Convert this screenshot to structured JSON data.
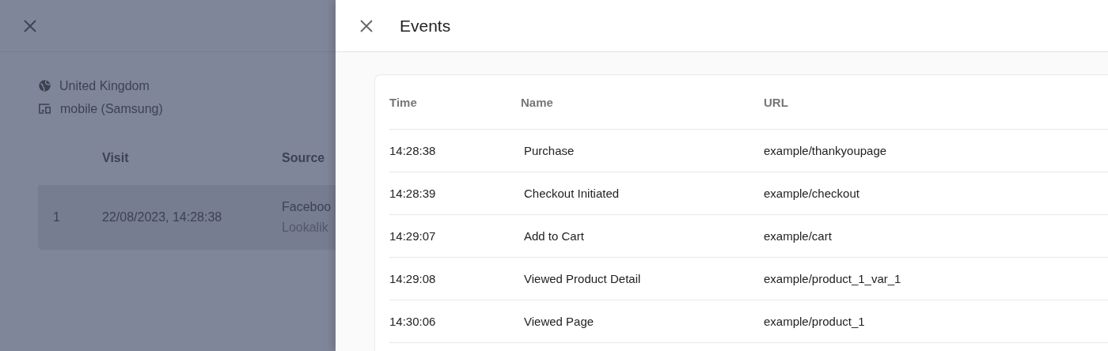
{
  "background_page": {
    "location": "United Kingdom",
    "device": "mobile (Samsung)",
    "visits_table": {
      "columns": [
        "Visit",
        "Source"
      ],
      "rows": [
        {
          "number": "1",
          "visit": "22/08/2023, 14:28:38",
          "source": "Faceboo",
          "campaign": "Lookalik"
        }
      ]
    }
  },
  "drawer": {
    "title": "Events",
    "table": {
      "columns": [
        "Time",
        "Name",
        "URL"
      ],
      "rows": [
        {
          "time": "14:28:38",
          "name": "Purchase",
          "url": "example/thankyoupage"
        },
        {
          "time": "14:28:39",
          "name": "Checkout Initiated",
          "url": "example/checkout"
        },
        {
          "time": "14:29:07",
          "name": "Add to Cart",
          "url": "example/cart"
        },
        {
          "time": "14:29:08",
          "name": "Viewed Product Detail",
          "url": "example/product_1_var_1"
        },
        {
          "time": "14:30:06",
          "name": "Viewed Page",
          "url": "example/product_1"
        }
      ]
    }
  }
}
